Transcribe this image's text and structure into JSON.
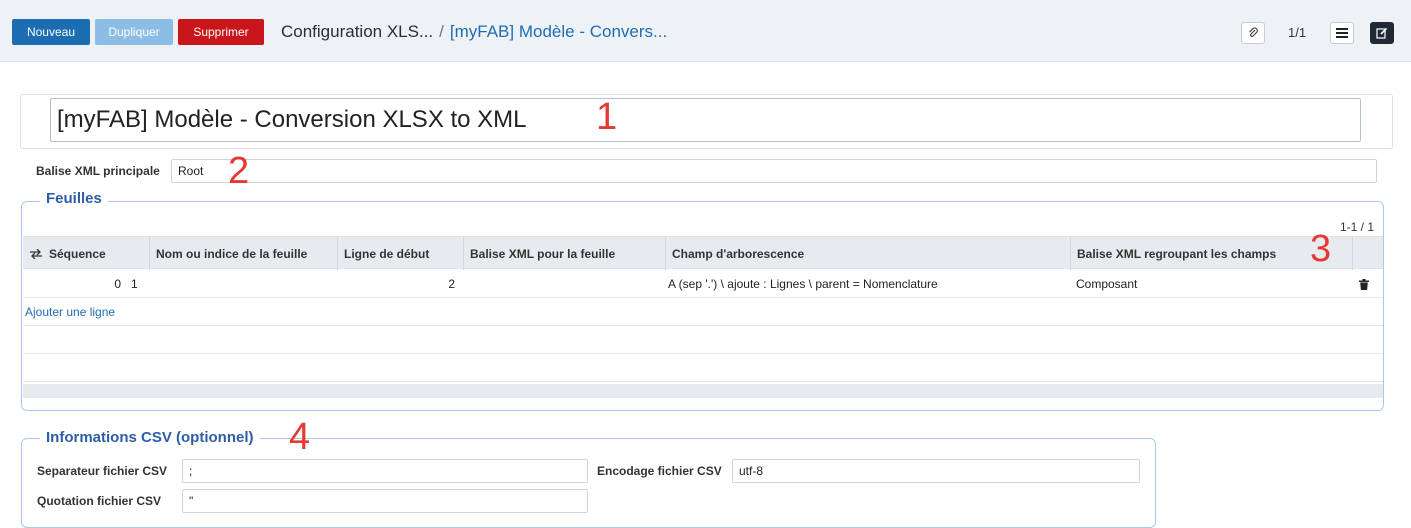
{
  "toolbar": {
    "new_label": "Nouveau",
    "duplicate_label": "Dupliquer",
    "delete_label": "Supprimer"
  },
  "breadcrumb": {
    "root": "Configuration XLS...",
    "separator": "/",
    "current": "[myFAB] Modèle - Convers..."
  },
  "pager": {
    "text": "1/1"
  },
  "form": {
    "title": "[myFAB] Modèle - Conversion XLSX to XML",
    "main_tag_label": "Balise XML principale",
    "main_tag_value": "Root"
  },
  "sheets": {
    "legend": "Feuilles",
    "pager": "1-1 / 1",
    "columns": {
      "sequence": "Séquence",
      "name": "Nom ou indice de la feuille",
      "start_line": "Ligne de début",
      "xml_tag": "Balise XML pour la feuille",
      "tree_field": "Champ d'arborescence",
      "group_tag": "Balise XML regroupant les champs"
    },
    "rows": [
      {
        "sequence": "0",
        "name": "1",
        "start_line": "2",
        "xml_tag": "",
        "tree_field": "A (sep '.') \\ ajoute : Lignes \\ parent = Nomenclature",
        "group_tag": "Composant"
      }
    ],
    "add_line_label": "Ajouter une ligne"
  },
  "csv": {
    "legend": "Informations CSV (optionnel)",
    "separator_label": "Separateur fichier CSV",
    "separator_value": ";",
    "encoding_label": "Encodage fichier CSV",
    "encoding_value": "utf-8",
    "quotation_label": "Quotation fichier CSV",
    "quotation_value": "\""
  },
  "annotations": [
    "1",
    "2",
    "3",
    "4"
  ],
  "icons": {
    "paperclip": "paperclip-icon",
    "list": "list-icon",
    "edit": "edit-icon",
    "sort": "sort-icon",
    "trash": "trash-icon"
  },
  "colors": {
    "primary": "#1d6db3",
    "secondary": "#8cbde6",
    "danger": "#c9161b",
    "legend": "#2e5ea8",
    "annotation": "#e53935"
  }
}
